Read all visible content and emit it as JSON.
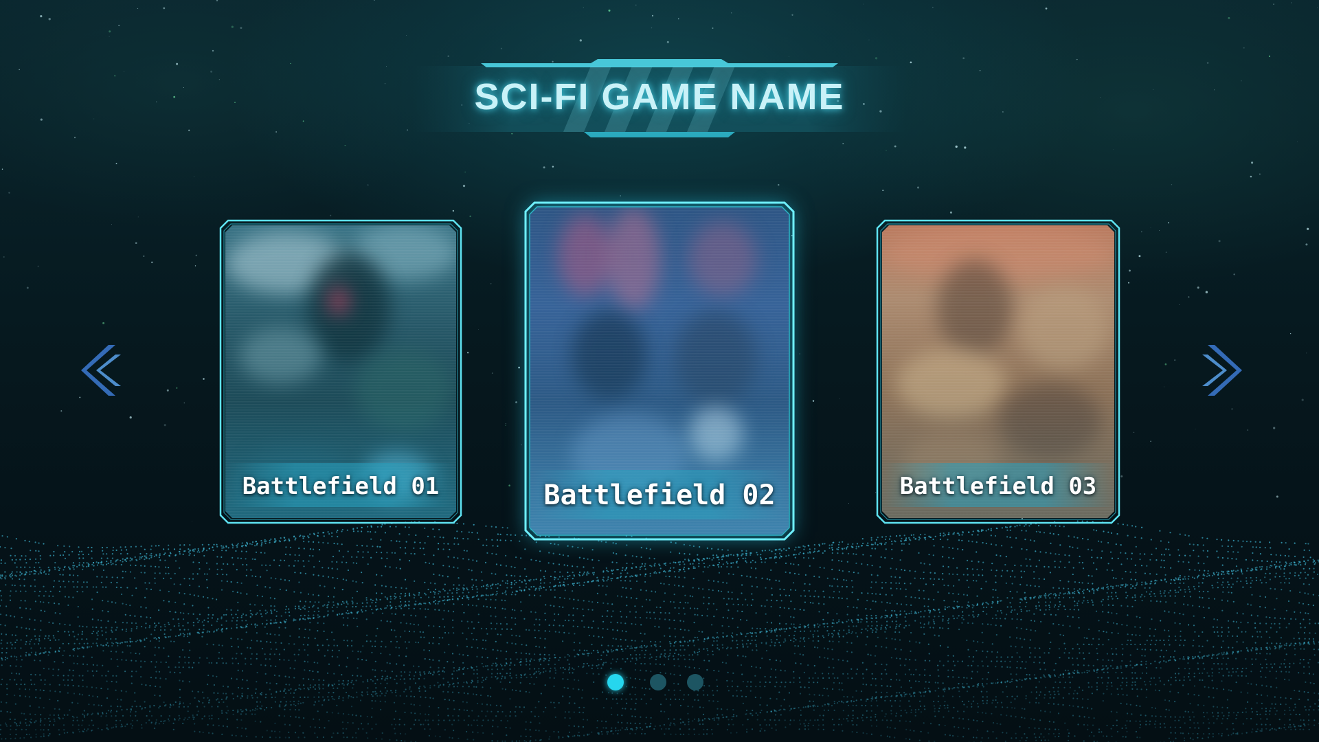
{
  "header": {
    "title": "SCI-FI GAME NAME"
  },
  "carousel": {
    "cards": [
      {
        "label": "Battlefield 01",
        "selected": false
      },
      {
        "label": "Battlefield 02",
        "selected": true
      },
      {
        "label": "Battlefield 03",
        "selected": false
      }
    ],
    "prev_icon": "chevron-left-icon",
    "next_icon": "chevron-right-icon"
  },
  "pagination": {
    "total": 3,
    "active_index": 0
  },
  "colors": {
    "accent": "#26d6ee",
    "frame": "#5fe3f2",
    "background": "#06191f"
  }
}
